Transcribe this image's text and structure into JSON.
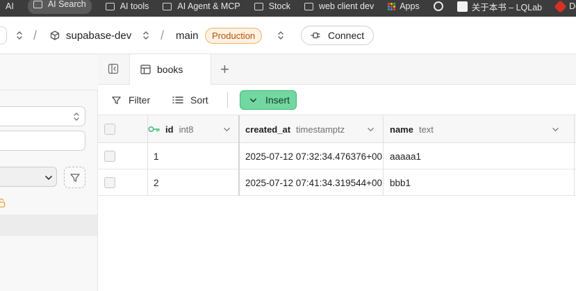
{
  "bookmarks": {
    "items": [
      {
        "label": "AI",
        "icon": "none"
      },
      {
        "label": "AI Search",
        "icon": "folder-icon",
        "active": true
      },
      {
        "label": "AI tools",
        "icon": "folder-icon"
      },
      {
        "label": "AI Agent & MCP",
        "icon": "folder-icon"
      },
      {
        "label": "Stock",
        "icon": "folder-icon"
      },
      {
        "label": "web client dev",
        "icon": "folder-icon"
      },
      {
        "label": "Apps",
        "icon": "apps-grid-icon"
      },
      {
        "label": "",
        "icon": "globe-icon"
      },
      {
        "label": "关于本书 – LQLab",
        "icon": "lqlab-favicon"
      },
      {
        "label": "Dot",
        "icon": "red-favicon"
      }
    ]
  },
  "topbar": {
    "project_name": "supabase-dev",
    "branch_name": "main",
    "env_badge": "Production",
    "connect_label": "Connect"
  },
  "tabs": {
    "active_tab": "books",
    "add_label": "+"
  },
  "toolbar": {
    "filter_label": "Filter",
    "sort_label": "Sort",
    "insert_label": "Insert"
  },
  "table": {
    "columns": [
      {
        "name": "id",
        "type": "int8",
        "primary_key": true
      },
      {
        "name": "created_at",
        "type": "timestamptz"
      },
      {
        "name": "name",
        "type": "text"
      }
    ],
    "rows": [
      {
        "id": "1",
        "created_at": "2025-07-12 07:32:34.476376+00",
        "name": "aaaaa1"
      },
      {
        "id": "2",
        "created_at": "2025-07-12 07:41:34.319544+00",
        "name": "bbb1"
      }
    ]
  },
  "colors": {
    "accent_green": "#72d7a0",
    "production_orange": "#b45309",
    "key_icon_green": "#3ebc74"
  }
}
